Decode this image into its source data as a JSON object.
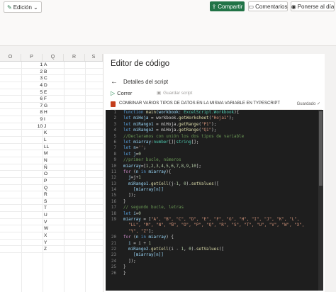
{
  "ribbon": {
    "mode_label": "Edición",
    "share_label": "Compartir",
    "comments_label": "Comentarios",
    "catchup_label": "Ponerse al día"
  },
  "grid": {
    "columns": [
      "O",
      "P",
      "Q",
      "R",
      "S"
    ],
    "rows": [
      {
        "n": "1",
        "l": "A"
      },
      {
        "n": "2",
        "l": "B"
      },
      {
        "n": "3",
        "l": "C"
      },
      {
        "n": "4",
        "l": "D"
      },
      {
        "n": "5",
        "l": "E"
      },
      {
        "n": "6",
        "l": "F"
      },
      {
        "n": "7",
        "l": "G"
      },
      {
        "n": "8",
        "l": "H"
      },
      {
        "n": "9",
        "l": "I"
      },
      {
        "n": "10",
        "l": "J"
      },
      {
        "n": "",
        "l": "K"
      },
      {
        "n": "",
        "l": "L"
      },
      {
        "n": "",
        "l": "LL"
      },
      {
        "n": "",
        "l": "M"
      },
      {
        "n": "",
        "l": "N"
      },
      {
        "n": "",
        "l": "Ñ"
      },
      {
        "n": "",
        "l": "O"
      },
      {
        "n": "",
        "l": "P"
      },
      {
        "n": "",
        "l": "Q"
      },
      {
        "n": "",
        "l": "R"
      },
      {
        "n": "",
        "l": "S"
      },
      {
        "n": "",
        "l": "T"
      },
      {
        "n": "",
        "l": "U"
      },
      {
        "n": "",
        "l": "V"
      },
      {
        "n": "",
        "l": "W"
      },
      {
        "n": "",
        "l": "X"
      },
      {
        "n": "",
        "l": "Y"
      },
      {
        "n": "",
        "l": "Z"
      }
    ]
  },
  "panel": {
    "title": "Editor de código",
    "details_label": "Detalles del script",
    "run_label": "Correr",
    "save_label": "Guardar script",
    "script_name": "COMBINAR VARIOS TIPOS DE DATOS EN LA MISMA VARIABLE EN TYPESCRIPT",
    "saved_label": "Guardado"
  },
  "colors": {
    "keyword": "#569cd6",
    "control": "#c586c0",
    "function": "#dcdcaa",
    "variable": "#9cdcfe",
    "type": "#4ec9b0",
    "string": "#ce9178",
    "number": "#b5cea8",
    "comment": "#6a9955",
    "share_green": "#217346"
  },
  "code_lines": [
    {
      "n": "1",
      "tokens": [
        {
          "t": "function ",
          "c": "keyword"
        },
        {
          "t": "main",
          "c": "function"
        },
        {
          "t": "(workbook: ",
          "c": "variable"
        },
        {
          "t": "ExcelScript.Workbook",
          "c": "type"
        },
        {
          "t": "){",
          "c": "plain"
        }
      ]
    },
    {
      "n": "2",
      "tokens": [
        {
          "t": "let ",
          "c": "keyword"
        },
        {
          "t": "miHoja ",
          "c": "variable"
        },
        {
          "t": "= workbook.",
          "c": "plain"
        },
        {
          "t": "getWorksheet",
          "c": "function"
        },
        {
          "t": "(",
          "c": "plain"
        },
        {
          "t": "\"Hoja1\"",
          "c": "string"
        },
        {
          "t": ");",
          "c": "plain"
        }
      ]
    },
    {
      "n": "3",
      "tokens": [
        {
          "t": "let ",
          "c": "keyword"
        },
        {
          "t": "miRango1 ",
          "c": "variable"
        },
        {
          "t": "= miHoja.",
          "c": "plain"
        },
        {
          "t": "getRange",
          "c": "function"
        },
        {
          "t": "(",
          "c": "plain"
        },
        {
          "t": "\"P1\"",
          "c": "string"
        },
        {
          "t": ");",
          "c": "plain"
        }
      ]
    },
    {
      "n": "4",
      "tokens": [
        {
          "t": "let ",
          "c": "keyword"
        },
        {
          "t": "miRango2 ",
          "c": "variable"
        },
        {
          "t": "= miHoja.",
          "c": "plain"
        },
        {
          "t": "getRange",
          "c": "function"
        },
        {
          "t": "(",
          "c": "plain"
        },
        {
          "t": "\"Q1\"",
          "c": "string"
        },
        {
          "t": ");",
          "c": "plain"
        }
      ]
    },
    {
      "n": "5",
      "tokens": [
        {
          "t": "//Declaramos con unión los dos tipos de variable",
          "c": "comment"
        }
      ]
    },
    {
      "n": "6",
      "tokens": [
        {
          "t": "let ",
          "c": "keyword"
        },
        {
          "t": "miarray",
          "c": "variable"
        },
        {
          "t": ":",
          "c": "plain"
        },
        {
          "t": "number",
          "c": "type"
        },
        {
          "t": "[]|",
          "c": "plain"
        },
        {
          "t": "string",
          "c": "type"
        },
        {
          "t": "[];",
          "c": "plain"
        }
      ]
    },
    {
      "n": "7",
      "tokens": [
        {
          "t": "let ",
          "c": "keyword"
        },
        {
          "t": "n",
          "c": "variable"
        },
        {
          "t": "=",
          "c": "plain"
        },
        {
          "t": "''",
          "c": "string"
        },
        {
          "t": ";",
          "c": "plain"
        }
      ]
    },
    {
      "n": "8",
      "tokens": [
        {
          "t": "let ",
          "c": "keyword"
        },
        {
          "t": "j",
          "c": "variable"
        },
        {
          "t": "=",
          "c": "plain"
        },
        {
          "t": "0",
          "c": "number"
        }
      ]
    },
    {
      "n": "9",
      "tokens": [
        {
          "t": "//primer bucle, números",
          "c": "comment"
        }
      ]
    },
    {
      "n": "10",
      "tokens": [
        {
          "t": "miarray",
          "c": "variable"
        },
        {
          "t": "=[",
          "c": "plain"
        },
        {
          "t": "1,2,3,4,5,6,7,8,9,10",
          "c": "number"
        },
        {
          "t": "];",
          "c": "plain"
        }
      ]
    },
    {
      "n": "11",
      "tokens": [
        {
          "t": "for ",
          "c": "control"
        },
        {
          "t": "(",
          "c": "plain"
        },
        {
          "t": "n ",
          "c": "variable"
        },
        {
          "t": "in ",
          "c": "keyword"
        },
        {
          "t": "miarray",
          "c": "variable"
        },
        {
          "t": "){",
          "c": "plain"
        }
      ]
    },
    {
      "n": "12",
      "tokens": [
        {
          "t": "  j",
          "c": "variable"
        },
        {
          "t": "=j+",
          "c": "plain"
        },
        {
          "t": "1",
          "c": "number"
        }
      ]
    },
    {
      "n": "13",
      "tokens": [
        {
          "t": "  miRango1.",
          "c": "variable"
        },
        {
          "t": "getCell",
          "c": "function"
        },
        {
          "t": "(j-",
          "c": "plain"
        },
        {
          "t": "1",
          "c": "number"
        },
        {
          "t": ", ",
          "c": "plain"
        },
        {
          "t": "0",
          "c": "number"
        },
        {
          "t": ").",
          "c": "plain"
        },
        {
          "t": "setValues",
          "c": "function"
        },
        {
          "t": "([",
          "c": "plain"
        }
      ]
    },
    {
      "n": "14",
      "tokens": [
        {
          "t": "    [miarray[n]]",
          "c": "variable"
        }
      ]
    },
    {
      "n": "15",
      "tokens": [
        {
          "t": "  ]);",
          "c": "plain"
        }
      ]
    },
    {
      "n": "16",
      "tokens": [
        {
          "t": "}",
          "c": "plain"
        }
      ]
    },
    {
      "n": "17",
      "tokens": [
        {
          "t": "// segundo bucle, letras",
          "c": "comment"
        }
      ]
    },
    {
      "n": "18",
      "tokens": [
        {
          "t": "let ",
          "c": "keyword"
        },
        {
          "t": "i",
          "c": "variable"
        },
        {
          "t": "=",
          "c": "plain"
        },
        {
          "t": "0",
          "c": "number"
        }
      ]
    },
    {
      "n": "19",
      "tokens": [
        {
          "t": "miarray ",
          "c": "variable"
        },
        {
          "t": "= [",
          "c": "plain"
        },
        {
          "t": "\"A\", \"B\", \"C\", \"D\", \"E\", \"F\", \"G\", \"H\", \"I\", \"J\", \"K\", \"L\",",
          "c": "string"
        }
      ]
    },
    {
      "n": "",
      "tokens": [
        {
          "t": "  \"LL\", \"M\", \"N\", \"Ñ\", \"O\", \"P\", \"Q\", \"R\", \"S\", \"T\", \"U\", \"V\", \"W\", \"X\",",
          "c": "string"
        }
      ]
    },
    {
      "n": "",
      "tokens": [
        {
          "t": "  \"Y\", \"Z\"",
          "c": "string"
        },
        {
          "t": "];",
          "c": "plain"
        }
      ]
    },
    {
      "n": "20",
      "tokens": [
        {
          "t": "for ",
          "c": "control"
        },
        {
          "t": "(",
          "c": "plain"
        },
        {
          "t": "n ",
          "c": "variable"
        },
        {
          "t": "in ",
          "c": "keyword"
        },
        {
          "t": "miarray",
          "c": "variable"
        },
        {
          "t": ") {",
          "c": "plain"
        }
      ]
    },
    {
      "n": "21",
      "tokens": [
        {
          "t": "  i ",
          "c": "variable"
        },
        {
          "t": "= i + ",
          "c": "plain"
        },
        {
          "t": "1",
          "c": "number"
        }
      ]
    },
    {
      "n": "22",
      "tokens": [
        {
          "t": "  miRango2.",
          "c": "variable"
        },
        {
          "t": "getCell",
          "c": "function"
        },
        {
          "t": "(i - ",
          "c": "plain"
        },
        {
          "t": "1",
          "c": "number"
        },
        {
          "t": ", ",
          "c": "plain"
        },
        {
          "t": "0",
          "c": "number"
        },
        {
          "t": ").",
          "c": "plain"
        },
        {
          "t": "setValues",
          "c": "function"
        },
        {
          "t": "([",
          "c": "plain"
        }
      ]
    },
    {
      "n": "23",
      "tokens": [
        {
          "t": "    [miarray[n]]",
          "c": "variable"
        }
      ]
    },
    {
      "n": "24",
      "tokens": [
        {
          "t": "  ]);",
          "c": "plain"
        }
      ]
    },
    {
      "n": "25",
      "tokens": [
        {
          "t": "}",
          "c": "plain"
        }
      ]
    },
    {
      "n": "26",
      "tokens": [
        {
          "t": "}",
          "c": "plain"
        }
      ]
    }
  ]
}
